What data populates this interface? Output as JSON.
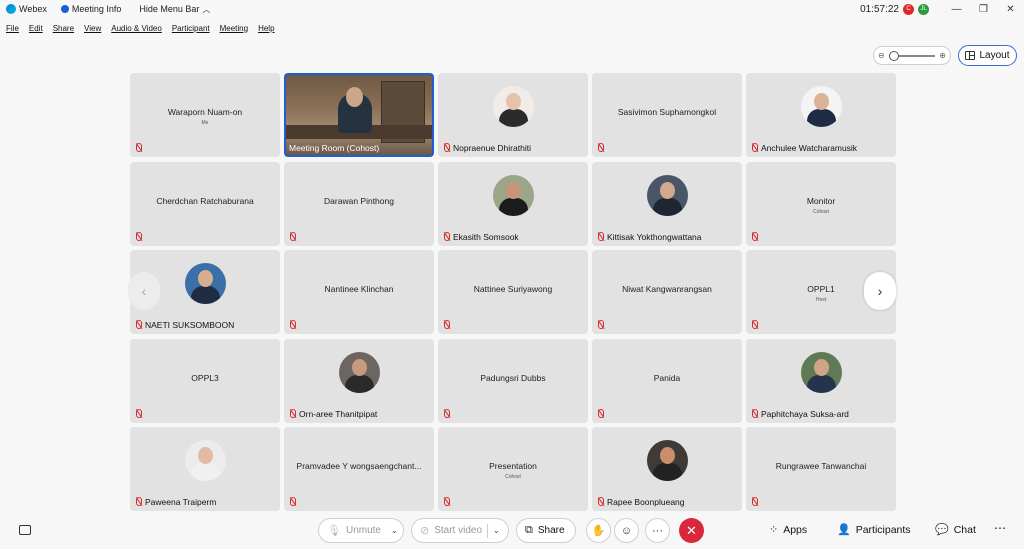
{
  "titlebar": {
    "app_name": "Webex",
    "meeting_info": "Meeting Info",
    "hide_menu_bar": "Hide Menu Bar",
    "clock": "01:57:22",
    "rec_badge": "C",
    "user_badge": "JL"
  },
  "menu": [
    "File",
    "Edit",
    "Share",
    "View",
    "Audio & Video",
    "Participant",
    "Meeting",
    "Help"
  ],
  "layout_button": "Layout",
  "tiles": [
    {
      "name": "Waraporn Nuam-on",
      "role": "Me",
      "kind": "name"
    },
    {
      "name": "Meeting Room (Cohost)",
      "kind": "video"
    },
    {
      "name": "Nopraenue Dhirathiti",
      "kind": "avatar",
      "skin": "#e6c2ad",
      "cloth": "#2b2b2b",
      "bg": "#f2ece8"
    },
    {
      "name": "Sasivimon Suphamongkol",
      "kind": "name"
    },
    {
      "name": "Anchulee Watcharamusik",
      "kind": "avatar",
      "skin": "#d9b298",
      "cloth": "#1f2a44",
      "bg": "#f4f4f4"
    },
    {
      "name": "Cherdchan Ratchaburana",
      "kind": "name"
    },
    {
      "name": "Darawan Pinthong",
      "kind": "name"
    },
    {
      "name": "Ekasith Somsook",
      "kind": "avatar",
      "skin": "#c99577",
      "cloth": "#1c1c1c",
      "bg": "#9aa58a"
    },
    {
      "name": "Kittisak Yokthongwattana",
      "kind": "avatar",
      "skin": "#d3a98b",
      "cloth": "#1e2634",
      "bg": "#4a5668"
    },
    {
      "name": "Monitor",
      "role": "Cohost",
      "kind": "name"
    },
    {
      "name": "NAETI SUKSOMBOON",
      "kind": "avatar",
      "skin": "#d7ae92",
      "cloth": "#1f2c44",
      "bg": "#3a6fa8"
    },
    {
      "name": "Nantinee Klinchan",
      "kind": "name",
      "no_foot": true
    },
    {
      "name": "Nattinee Suriyawong",
      "kind": "name",
      "no_foot": true
    },
    {
      "name": "Niwat Kangwanrangsan",
      "kind": "name",
      "no_foot": true
    },
    {
      "name": "OPPL1",
      "role": "Host",
      "kind": "name"
    },
    {
      "name": "OPPL3",
      "kind": "name"
    },
    {
      "name": "Orn-aree Thanitpipat",
      "kind": "avatar",
      "skin": "#c79a7e",
      "cloth": "#2a2a2a",
      "bg": "#6d6660"
    },
    {
      "name": "Padungsri Dubbs",
      "kind": "name"
    },
    {
      "name": "Panida",
      "kind": "name"
    },
    {
      "name": "Paphitchaya Suksa-ard",
      "kind": "avatar",
      "skin": "#d2a486",
      "cloth": "#24344c",
      "bg": "#5f7a55"
    },
    {
      "name": "Paweena Traiperm",
      "kind": "avatar",
      "skin": "#e2bba2",
      "cloth": "#f0f0f0",
      "bg": "#ececec"
    },
    {
      "name": "Pramvadee Y wongsaengchant...",
      "kind": "name"
    },
    {
      "name": "Presentation",
      "role": "Cohost",
      "kind": "name"
    },
    {
      "name": "Rapee Boonplueang",
      "kind": "avatar",
      "skin": "#c98e6c",
      "cloth": "#222",
      "bg": "#3f3a35"
    },
    {
      "name": "Rungrawee Tanwanchai",
      "kind": "name"
    }
  ],
  "controls": {
    "unmute": "Unmute",
    "start_video": "Start video",
    "share": "Share",
    "apps": "Apps",
    "participants": "Participants",
    "chat": "Chat"
  }
}
